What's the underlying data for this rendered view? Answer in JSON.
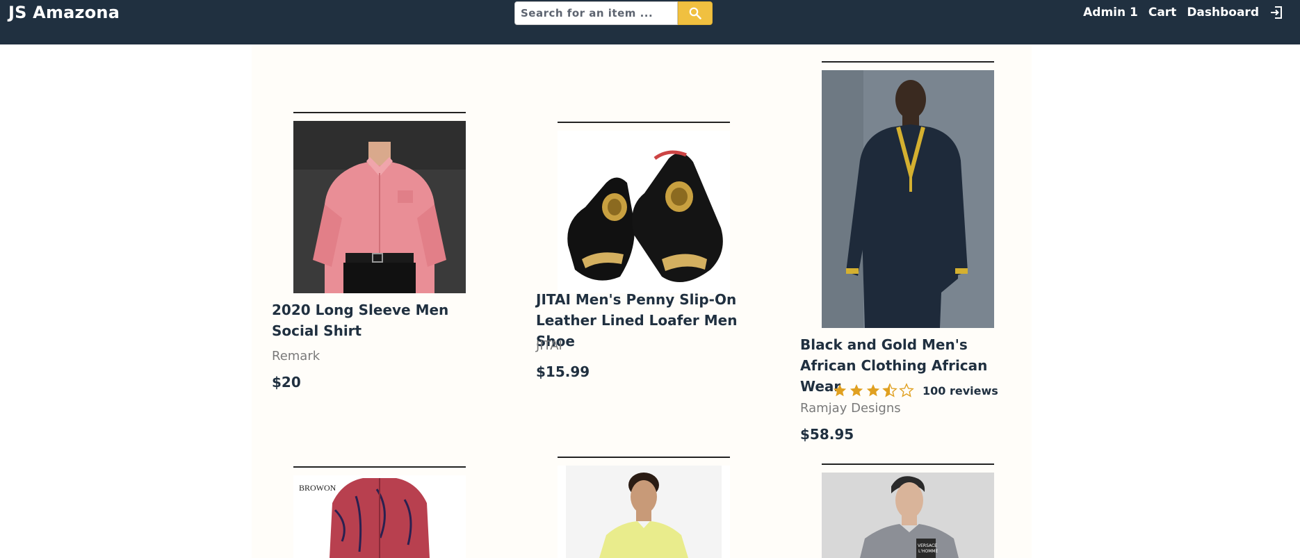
{
  "header": {
    "brand": "JS Amazona",
    "search_placeholder": "Search for an item ...",
    "search_icon": "search-icon",
    "nav": {
      "user": "Admin 1",
      "cart": "Cart",
      "dashboard": "Dashboard",
      "signout_icon": "sign-out-icon"
    }
  },
  "colors": {
    "header_bg": "#203040",
    "accent": "#f0c040",
    "star": "#e0a020"
  },
  "products": [
    {
      "name": "2020 Long Sleeve Men Social Shirt",
      "brand": "Remark",
      "price": "$20"
    },
    {
      "name": "JITAI Men's Penny Slip-On Leather Lined Loafer Men Shoe",
      "brand": "JITAI",
      "price": "$15.99"
    },
    {
      "name": "Black and Gold Men's African Clothing African Wear",
      "brand": "Ramjay Designs",
      "price": "$58.95",
      "rating": 3.5,
      "rating_max": 5,
      "reviews": "100 reviews"
    },
    {
      "image_text": "BROWON"
    },
    {},
    {
      "image_text": "VERSACE L'HOMME"
    }
  ]
}
